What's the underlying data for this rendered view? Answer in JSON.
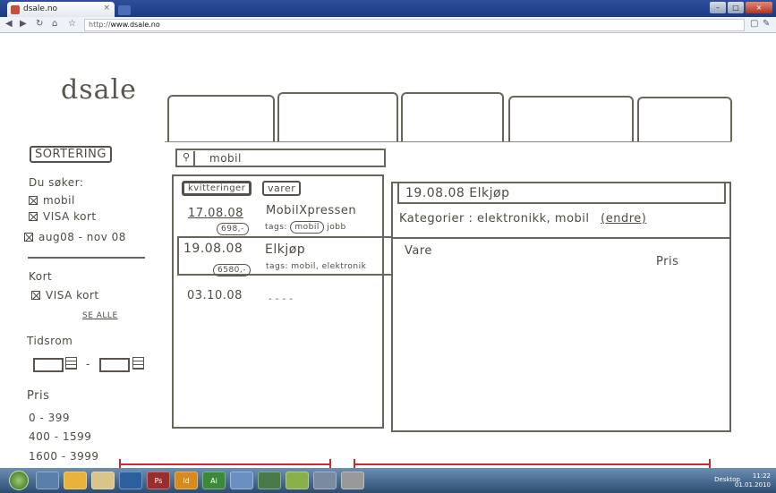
{
  "browser": {
    "tab_title": "dsale.no",
    "url_prefix": "http://",
    "url_host": "www.dsale.no"
  },
  "page": {
    "logo": "dsale",
    "sidebar": {
      "sort_button": "SORTERING",
      "search_header": "Du søker:",
      "search_items": [
        "mobil",
        "VISA kort",
        "aug08 - nov 08"
      ],
      "card_header": "Kort",
      "card_item": "VISA kort",
      "see_all": "SE ALLE",
      "period_header": "Tidsrom",
      "period_sep": "-",
      "price_header": "Pris",
      "price_ranges": [
        "0 - 399",
        "400 - 1599",
        "1600 - 3999"
      ]
    },
    "search": {
      "query": "mobil"
    },
    "list_tabs": {
      "receipts": "kvitteringer",
      "items": "varer"
    },
    "receipts": [
      {
        "date": "17.08.08",
        "amount": "698,-",
        "store": "MobilXpressen",
        "tags_label": "tags:",
        "tags": [
          "mobil",
          "jobb"
        ]
      },
      {
        "date": "19.08.08",
        "amount": "6580,-",
        "store": "Elkjøp",
        "tags_label": "tags:",
        "tags_text": "mobil, elektronik"
      },
      {
        "date": "03.10.08",
        "dots": "- - - -"
      }
    ],
    "detail": {
      "header": "19.08.08  Elkjøp",
      "categories_label": "Kategorier :",
      "categories_value": "elektronikk, mobil",
      "edit_link": "(endre)",
      "col_item": "Vare",
      "col_price": "Pris"
    }
  },
  "taskbar": {
    "apps": [
      "",
      "",
      "",
      "",
      "Ps",
      "Id",
      "Ai",
      "",
      "",
      "",
      "",
      ""
    ],
    "tray_lang": "Desktop",
    "clock_time": "11:22",
    "clock_date": "01.01.2010"
  },
  "colors": {
    "sketch_ink": "#4f4a42",
    "annotation_red": "#cc2a2a",
    "title_blue": "#1b3a86"
  }
}
